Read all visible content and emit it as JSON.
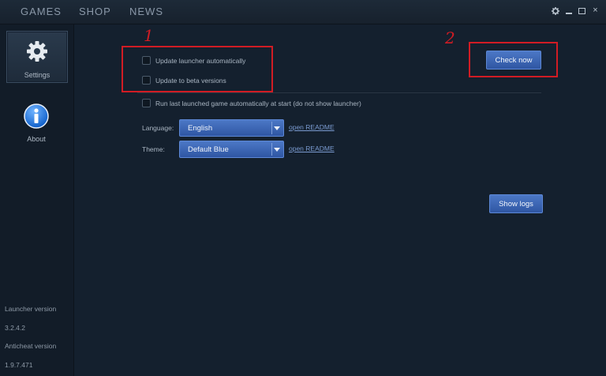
{
  "topnav": {
    "games": "GAMES",
    "shop": "SHOP",
    "news": "NEWS"
  },
  "window": {
    "min": "minimize",
    "max": "maximize",
    "close": "×"
  },
  "sidebar": {
    "items": [
      {
        "label": "Settings",
        "icon": "gear-icon"
      },
      {
        "label": "About",
        "icon": "info-icon"
      }
    ],
    "launcher_version_label": "Launcher version",
    "launcher_version": "3.2.4.2",
    "anticheat_version_label": "Anticheat version",
    "anticheat_version": "1.9.7.471"
  },
  "settings": {
    "update_auto": "Update launcher automatically",
    "update_beta": "Update to beta versions",
    "run_last": "Run last launched game automatically at start (do not show launcher)",
    "check_now": "Check now",
    "language_label": "Language:",
    "language_value": "English",
    "theme_label": "Theme:",
    "theme_value": "Default Blue",
    "open_readme": "open README",
    "show_logs": "Show logs"
  },
  "annotations": {
    "one": "1",
    "two": "2"
  },
  "colors": {
    "accent": "#3b66b5",
    "annotation": "#d11c24",
    "background": "#14202e"
  }
}
